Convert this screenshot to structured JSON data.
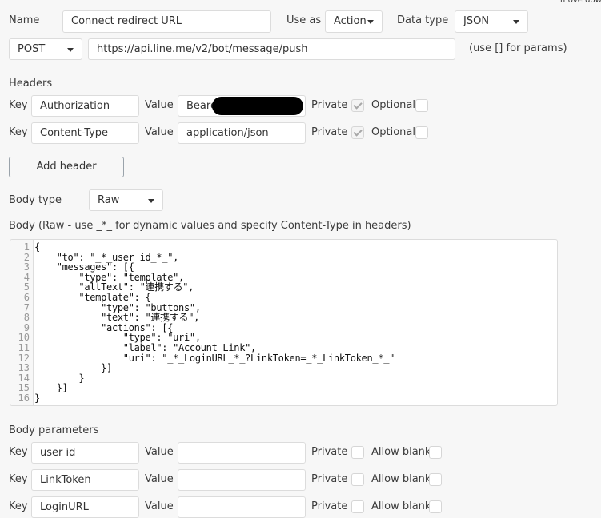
{
  "corner_hint": "move down",
  "call": {
    "name_label": "Name",
    "name_value": "Connect redirect URL",
    "use_as_label": "Use as",
    "use_as_value": "Action",
    "data_type_label": "Data type",
    "data_type_value": "JSON",
    "method_value": "POST",
    "url_value": "https://api.line.me/v2/bot/message/push",
    "url_hint": "(use [] for params)"
  },
  "headers": {
    "title": "Headers",
    "key_label": "Key",
    "value_label": "Value",
    "private_label": "Private",
    "optional_label": "Optional",
    "rows": [
      {
        "key": "Authorization",
        "value": "Beare",
        "redacted": true,
        "private": true,
        "optional": false
      },
      {
        "key": "Content-Type",
        "value": "application/json",
        "redacted": false,
        "private": true,
        "optional": false
      }
    ],
    "add_button": "Add header"
  },
  "body": {
    "type_label": "Body type",
    "type_value": "Raw",
    "raw_label": "Body (Raw - use _*_ for dynamic values and specify Content-Type in headers)",
    "line_numbers": [
      "1",
      "2",
      "3",
      "4",
      "5",
      "6",
      "7",
      "8",
      "9",
      "10",
      "11",
      "12",
      "13",
      "14",
      "15",
      "16"
    ],
    "code_lines": [
      "{",
      "    \"to\": \"_*_user id_*_\",",
      "    \"messages\": [{",
      "        \"type\": \"template\",",
      "        \"altText\": \"連携する\",",
      "        \"template\": {",
      "            \"type\": \"buttons\",",
      "            \"text\": \"連携する\",",
      "            \"actions\": [{",
      "                \"type\": \"uri\",",
      "                \"label\": \"Account Link\",",
      "                \"uri\": \"_*_LoginURL_*_?LinkToken=_*_LinkToken_*_\"",
      "            }]",
      "        }",
      "    }]",
      "}"
    ]
  },
  "body_params": {
    "title": "Body parameters",
    "key_label": "Key",
    "value_label": "Value",
    "private_label": "Private",
    "allow_blank_label": "Allow blank",
    "rows": [
      {
        "key": "user id",
        "value": "",
        "private": false,
        "allow_blank": false
      },
      {
        "key": "LinkToken",
        "value": "",
        "private": false,
        "allow_blank": false
      },
      {
        "key": "LoginURL",
        "value": "",
        "private": false,
        "allow_blank": false
      }
    ]
  }
}
